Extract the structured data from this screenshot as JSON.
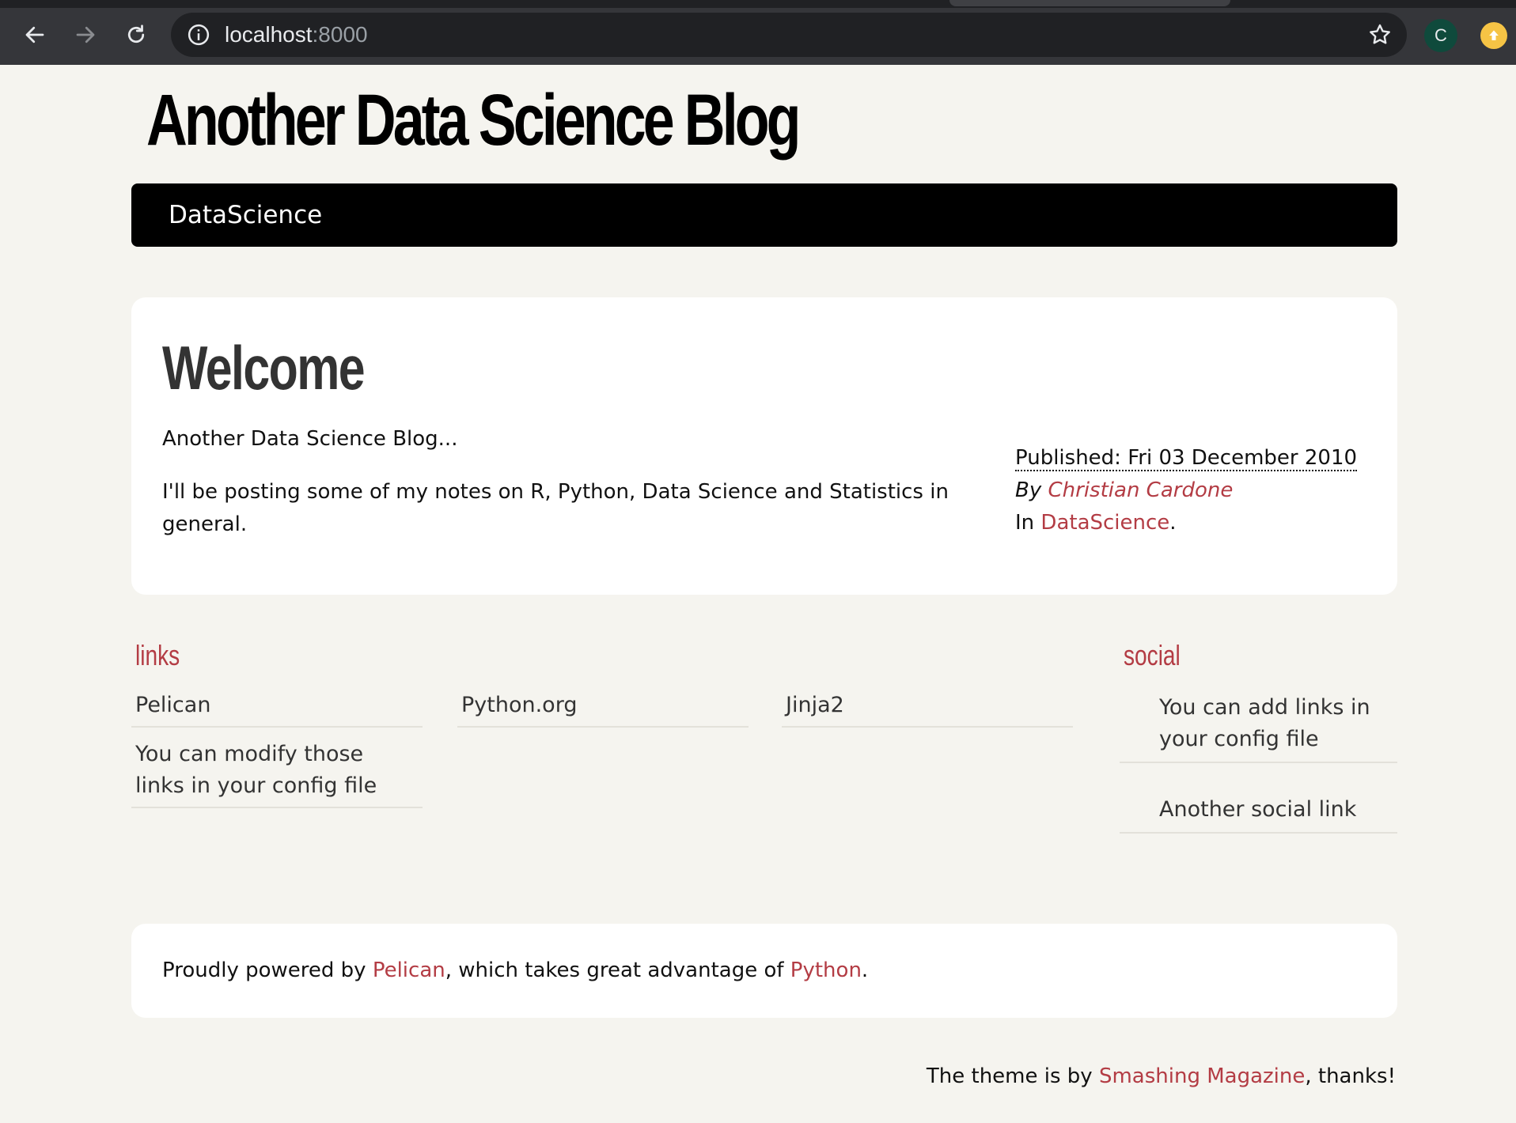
{
  "browser": {
    "url_host": "localhost",
    "url_port": ":8000",
    "profile_initial": "C"
  },
  "site": {
    "title": "Another Data Science Blog",
    "menu_item": "DataScience"
  },
  "article": {
    "title": "Welcome",
    "intro": "Another Data Science Blog...",
    "body": "I'll be posting some of my notes on R, Python, Data Science and Statistics in general.",
    "published": "Published: Fri 03 December 2010",
    "by_label": "By",
    "author": "Christian Cardone",
    "in_label": "In",
    "category": "DataScience",
    "period": "."
  },
  "blogroll": {
    "title": "links",
    "items": [
      "Pelican",
      "Python.org",
      "Jinja2",
      "You can modify those links in your config file"
    ]
  },
  "social": {
    "title": "social",
    "items": [
      "You can add links in your config file",
      "Another social link"
    ]
  },
  "footer": {
    "prefix": "Proudly powered by ",
    "pelican": "Pelican",
    "middle": ", which takes great advantage of ",
    "python": "Python",
    "end": ".",
    "theme_prefix": "The theme is by ",
    "theme_link": "Smashing Magazine",
    "theme_suffix": ", thanks!"
  }
}
